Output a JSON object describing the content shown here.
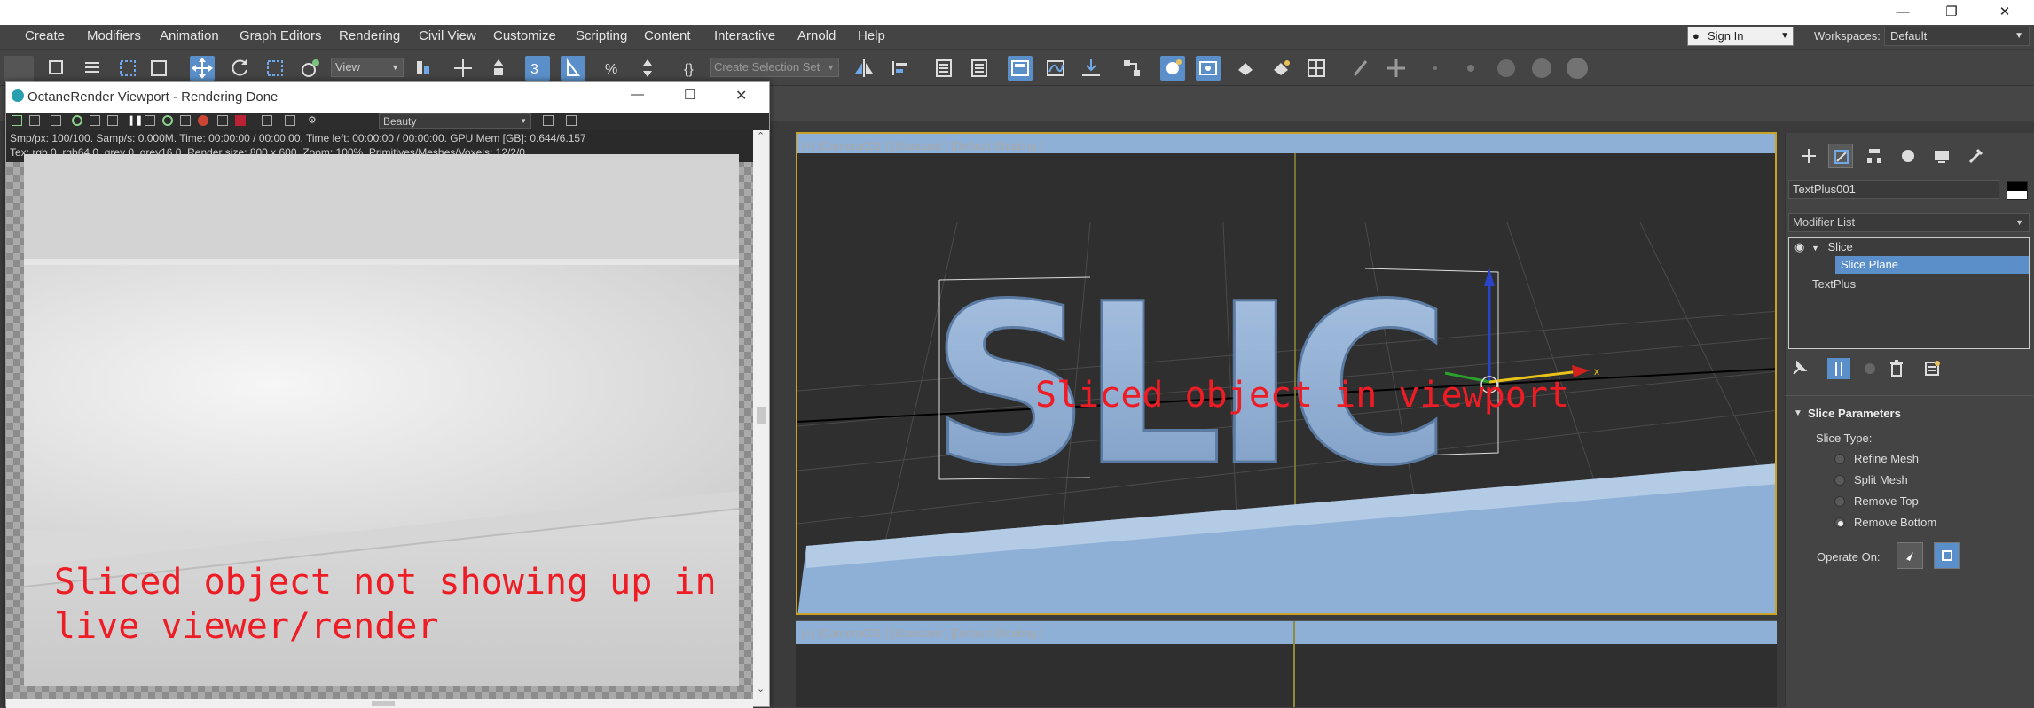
{
  "window": {
    "controls": [
      "—",
      "❐",
      "✕"
    ]
  },
  "menubar": {
    "items": [
      "Create",
      "Modifiers",
      "Animation",
      "Graph Editors",
      "Rendering",
      "Civil View",
      "Customize",
      "Scripting",
      "Content",
      "Interactive",
      "Arnold",
      "Help"
    ],
    "signin_label": "Sign In",
    "workspaces_label": "Workspaces:",
    "workspace_value": "Default"
  },
  "toolbar": {
    "view_select": "View",
    "selection_set_placeholder": "Create Selection Set"
  },
  "octane": {
    "title": "OctaneRender Viewport - Rendering Done",
    "pass_select": "Beauty",
    "info_line1": "Smp/px: 100/100.   Samp/s: 0.000M.   Time: 00:00:00 / 00:00:00.   Time left: 00:00:00 / 00:00:00.   GPU Mem [GB]: 0.644/6.157",
    "info_line2": "Tex: rgb 0, rgb64 0, grey 0, grey16 0.   Render size: 800 x 600.   Zoom: 100%.   Primitives/Meshes/Voxels: 12/2/0",
    "annotation_line1": "Sliced object not showing up in",
    "annotation_line2": "live viewer/render"
  },
  "viewport": {
    "label": "[+] [Camera001 ] [Standard ] [Default Shading ]",
    "text3d": "SLIC",
    "annotation": "Sliced object in viewport",
    "axis_x_label": "x"
  },
  "viewport2": {
    "label": "[+] [Camera001 ] [Standard ] [Default Shading ]"
  },
  "command_panel": {
    "object_name": "TextPlus001",
    "modifier_list_label": "Modifier List",
    "stack": [
      {
        "label": "Slice"
      },
      {
        "label": "Slice Plane"
      },
      {
        "label": "TextPlus"
      }
    ],
    "rollout_title": "Slice Parameters",
    "slice_type_label": "Slice Type:",
    "slice_types": [
      "Refine Mesh",
      "Split Mesh",
      "Remove Top",
      "Remove Bottom"
    ],
    "selected_slice_type": "Remove Bottom",
    "operate_on_label": "Operate On:"
  },
  "colors": {
    "accent": "#5b8fc9",
    "annotation_red": "#ee1c24",
    "viewport_border": "#c9a227",
    "object_blue": "#8fb0d6"
  }
}
